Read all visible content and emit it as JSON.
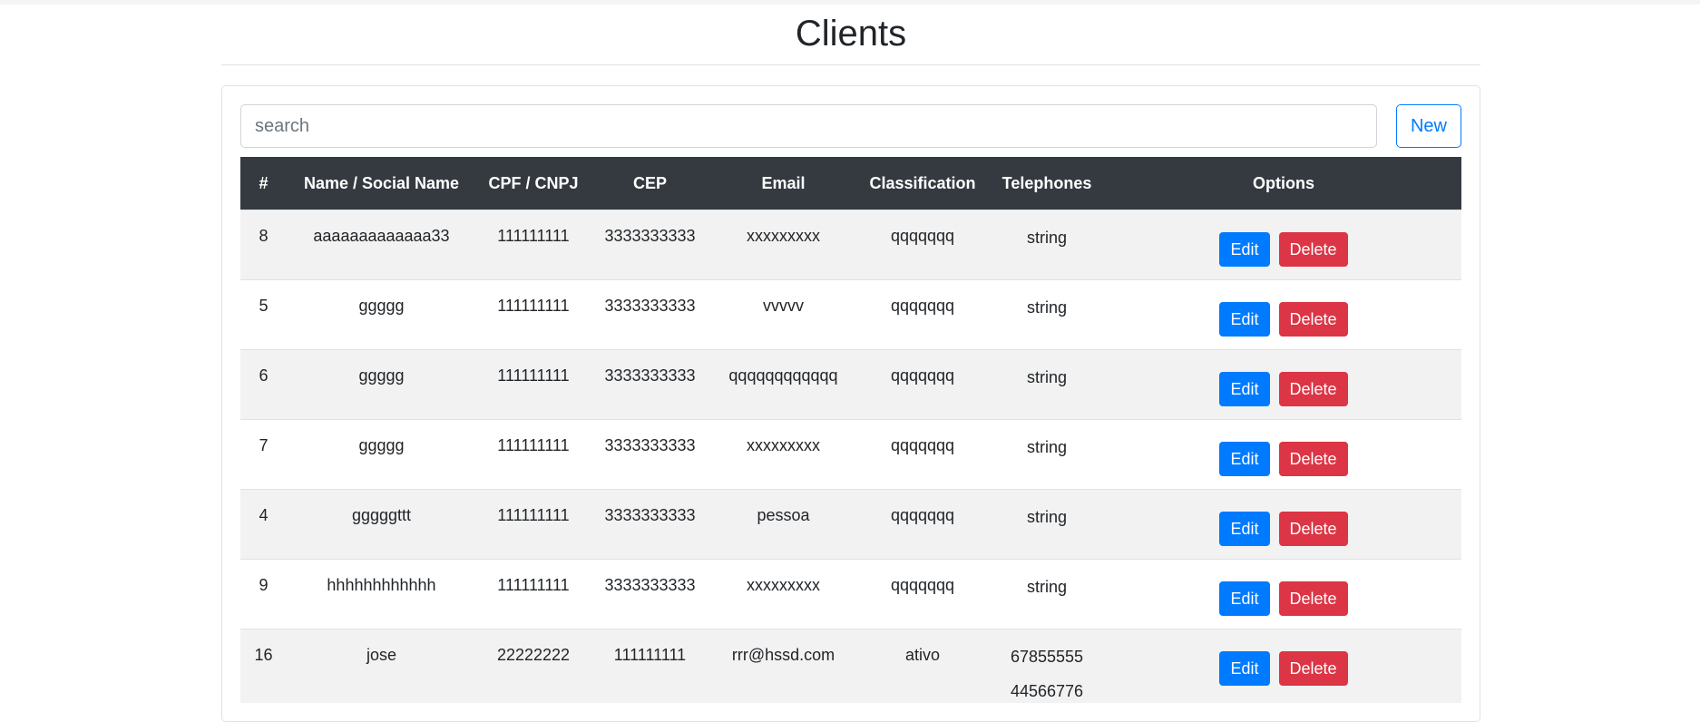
{
  "page": {
    "title": "Clients"
  },
  "search": {
    "placeholder": "search",
    "value": ""
  },
  "toolbar": {
    "new_label": "New"
  },
  "table": {
    "headers": [
      "#",
      "Name / Social Name",
      "CPF / CNPJ",
      "CEP",
      "Email",
      "Classification",
      "Telephones",
      "Options"
    ],
    "rows": [
      {
        "id": "8",
        "name": "aaaaaaaaaaaaa33",
        "doc": "111111111",
        "cep": "3333333333",
        "email": "xxxxxxxxx",
        "classification": "qqqqqqq",
        "telephones": [
          "string"
        ],
        "edit": "Edit",
        "delete": "Delete"
      },
      {
        "id": "5",
        "name": "ggggg",
        "doc": "111111111",
        "cep": "3333333333",
        "email": "vvvvv",
        "classification": "qqqqqqq",
        "telephones": [
          "string"
        ],
        "edit": "Edit",
        "delete": "Delete"
      },
      {
        "id": "6",
        "name": "ggggg",
        "doc": "111111111",
        "cep": "3333333333",
        "email": "qqqqqqqqqqqq",
        "classification": "qqqqqqq",
        "telephones": [
          "string"
        ],
        "edit": "Edit",
        "delete": "Delete"
      },
      {
        "id": "7",
        "name": "ggggg",
        "doc": "111111111",
        "cep": "3333333333",
        "email": "xxxxxxxxx",
        "classification": "qqqqqqq",
        "telephones": [
          "string"
        ],
        "edit": "Edit",
        "delete": "Delete"
      },
      {
        "id": "4",
        "name": "gggggttt",
        "doc": "111111111",
        "cep": "3333333333",
        "email": "pessoa",
        "classification": "qqqqqqq",
        "telephones": [
          "string"
        ],
        "edit": "Edit",
        "delete": "Delete"
      },
      {
        "id": "9",
        "name": "hhhhhhhhhhhh",
        "doc": "111111111",
        "cep": "3333333333",
        "email": "xxxxxxxxx",
        "classification": "qqqqqqq",
        "telephones": [
          "string"
        ],
        "edit": "Edit",
        "delete": "Delete"
      },
      {
        "id": "16",
        "name": "jose",
        "doc": "22222222",
        "cep": "111111111",
        "email": "rrr@hssd.com",
        "classification": "ativo",
        "telephones": [
          "67855555",
          "44566776"
        ],
        "edit": "Edit",
        "delete": "Delete"
      }
    ]
  },
  "colors": {
    "header_bg": "#343a40",
    "primary": "#007bff",
    "danger": "#dc3545",
    "stripe": "#f2f2f2"
  }
}
